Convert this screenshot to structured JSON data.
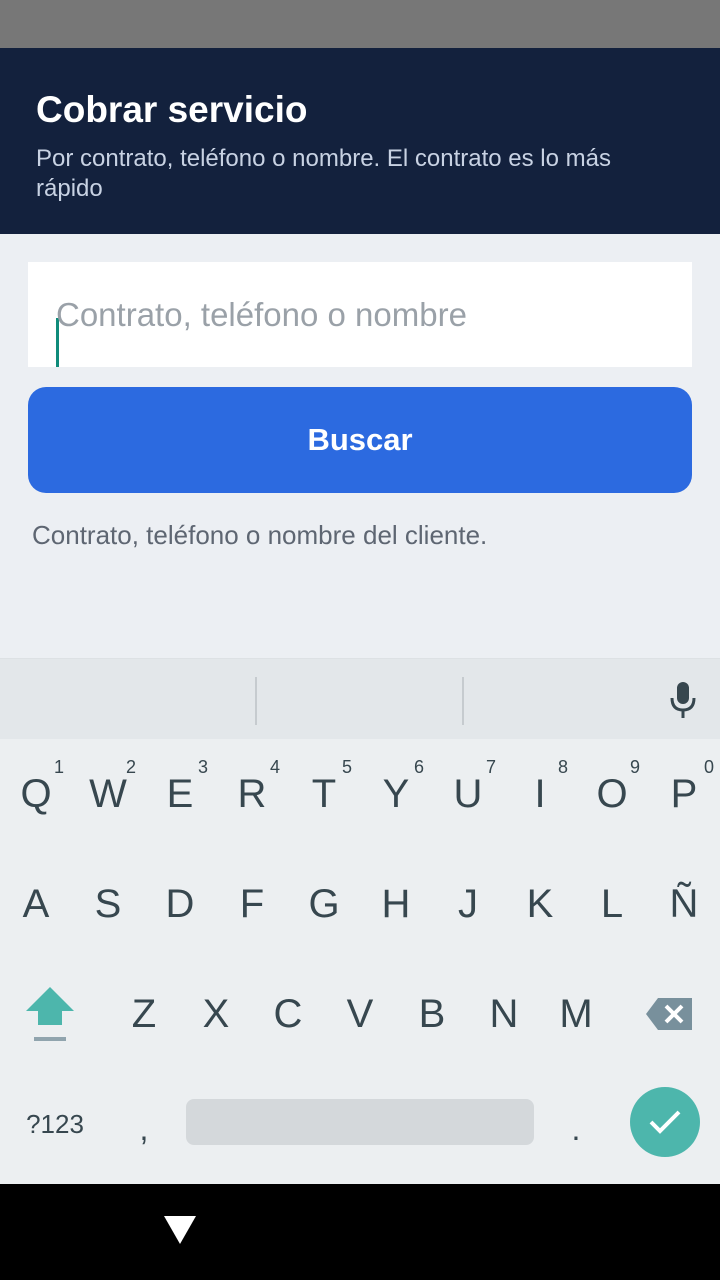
{
  "header": {
    "title": "Cobrar servicio",
    "subtitle": "Por contrato, teléfono o nombre. El contrato es lo más rápido"
  },
  "search": {
    "placeholder": "Contrato, teléfono o nombre",
    "value": ""
  },
  "buscar_label": "Buscar",
  "helper_text": "Contrato, teléfono o nombre del cliente.",
  "keyboard": {
    "row1": [
      {
        "letter": "Q",
        "hint": "1"
      },
      {
        "letter": "W",
        "hint": "2"
      },
      {
        "letter": "E",
        "hint": "3"
      },
      {
        "letter": "R",
        "hint": "4"
      },
      {
        "letter": "T",
        "hint": "5"
      },
      {
        "letter": "Y",
        "hint": "6"
      },
      {
        "letter": "U",
        "hint": "7"
      },
      {
        "letter": "I",
        "hint": "8"
      },
      {
        "letter": "O",
        "hint": "9"
      },
      {
        "letter": "P",
        "hint": "0"
      }
    ],
    "row2": [
      "A",
      "S",
      "D",
      "F",
      "G",
      "H",
      "J",
      "K",
      "L",
      "Ñ"
    ],
    "row3": [
      "Z",
      "X",
      "C",
      "V",
      "B",
      "N",
      "M"
    ],
    "symbols_label": "?123",
    "comma_label": ",",
    "period_label": "."
  },
  "icons": {
    "mic": "mic-icon",
    "shift": "shift-icon",
    "backspace": "backspace-icon",
    "enter": "check-icon",
    "back": "back-triangle-icon"
  },
  "colors": {
    "header_bg": "#13213d",
    "accent_button": "#2c6ae0",
    "caret": "#0f8b7a",
    "enter_key": "#4db6ac"
  }
}
